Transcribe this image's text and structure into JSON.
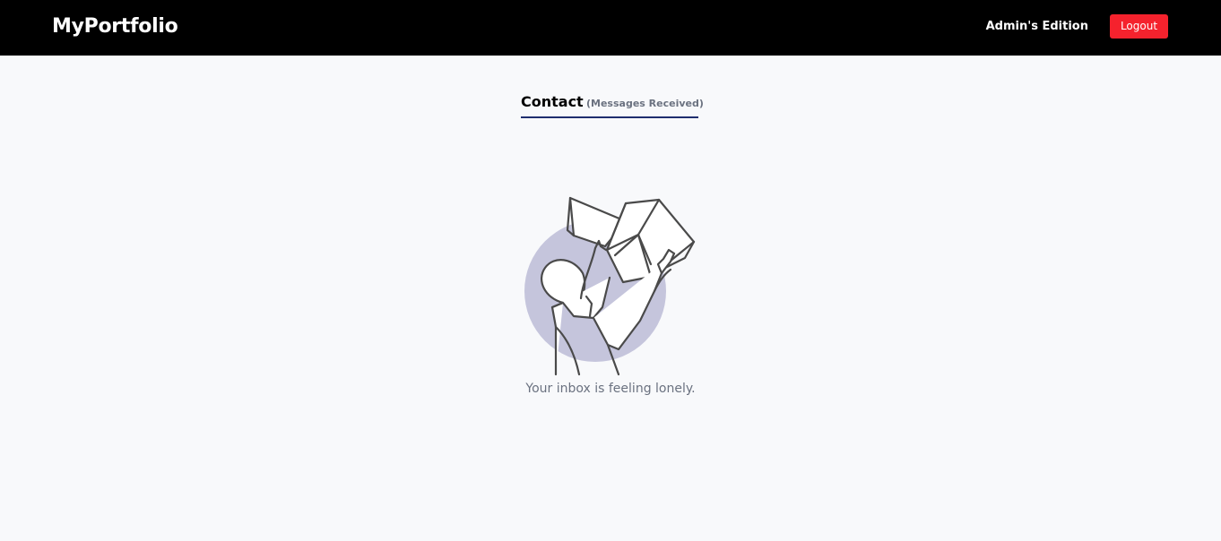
{
  "header": {
    "brand": "MyPortfolio",
    "edition_label": "Admin's Edition",
    "logout_label": "Logout"
  },
  "main": {
    "tab_title": "Contact",
    "tab_subtitle": "(Messages Received)",
    "empty_message": "Your inbox is feeling lonely."
  },
  "colors": {
    "navbar_bg": "#000000",
    "logout_bg": "#f5222d",
    "tab_underline": "#1f2e6e",
    "illustration_circle": "#c5c5dc",
    "page_bg": "#f8f9fb"
  },
  "icons": {
    "empty_state": "person-opening-box-illustration"
  }
}
